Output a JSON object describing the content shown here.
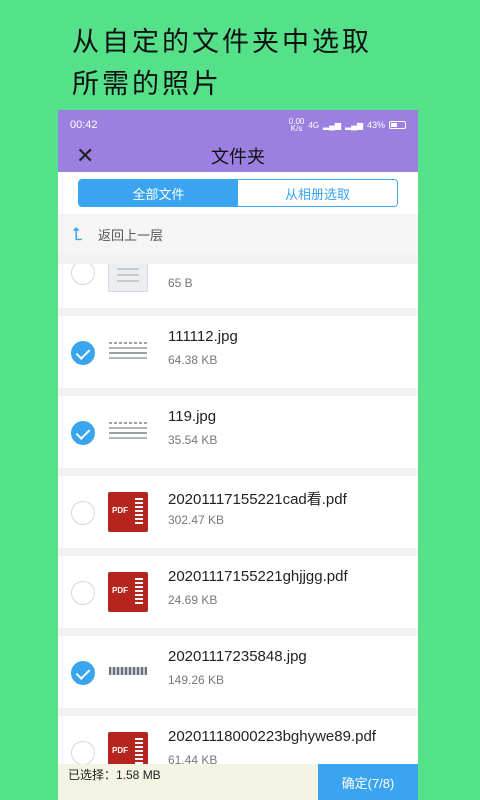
{
  "promo": {
    "line1": "从自定的文件夹中选取",
    "line2": "所需的照片"
  },
  "status_bar": {
    "time": "00:42",
    "speed": "0.00",
    "speed_unit": "K/s",
    "network": "4G",
    "battery": "43%"
  },
  "title_bar": {
    "close_icon": "close-icon",
    "title": "文件夹"
  },
  "tabs": [
    {
      "label": "全部文件",
      "active": true
    },
    {
      "label": "从相册选取",
      "active": false
    }
  ],
  "back": {
    "icon": "back-arrow-icon",
    "label": "返回上一层"
  },
  "files": [
    {
      "name": "",
      "size": "65 B",
      "type": "doc",
      "checked": false
    },
    {
      "name": "111112.jpg",
      "size": "64.38 KB",
      "type": "image",
      "checked": true
    },
    {
      "name": "119.jpg",
      "size": "35.54 KB",
      "type": "image",
      "checked": true
    },
    {
      "name": "20201117155221cad看.pdf",
      "size": "302.47 KB",
      "type": "pdf",
      "checked": false
    },
    {
      "name": "20201117155221ghjjgg.pdf",
      "size": "24.69 KB",
      "type": "pdf",
      "checked": false
    },
    {
      "name": "20201117235848.jpg",
      "size": "149.26 KB",
      "type": "image",
      "checked": true
    },
    {
      "name": "20201118000223bghywe89.pdf",
      "size": "61.44 KB",
      "type": "pdf",
      "checked": false
    }
  ],
  "pdf_badge": "PDF",
  "bottom": {
    "selected_text": "已选择：1.58 MB",
    "confirm_label": "确定(7/8)"
  },
  "colors": {
    "background": "#55e08a",
    "header": "#9b80e2",
    "accent": "#3aa4f0"
  }
}
